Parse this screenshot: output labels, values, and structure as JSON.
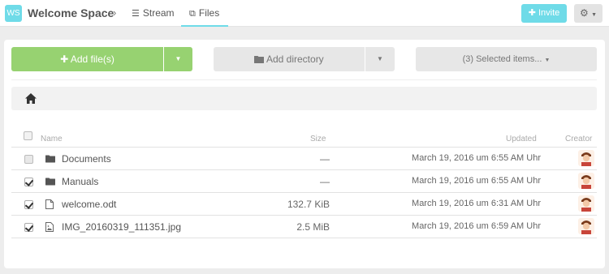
{
  "header": {
    "space_initials": "WS",
    "space_name": "Welcome Space",
    "separator": "›",
    "nav_stream": "Stream",
    "nav_files": "Files",
    "invite_label": "Invite",
    "accent_color": "#6fdbe8"
  },
  "toolbar": {
    "add_files_label": "Add file(s)",
    "add_directory_label": "Add directory",
    "selected_items_label": "(3) Selected items...",
    "add_files_color": "#97d271"
  },
  "table": {
    "columns": {
      "name": "Name",
      "size": "Size",
      "updated": "Updated",
      "creator": "Creator"
    },
    "rows": [
      {
        "type": "folder",
        "name": "Documents",
        "size": "—",
        "updated": "March 19, 2016 um 6:55 AM Uhr",
        "checked": false,
        "icon": "folder-icon"
      },
      {
        "type": "folder",
        "name": "Manuals",
        "size": "—",
        "updated": "March 19, 2016 um 6:55 AM Uhr",
        "checked": true,
        "icon": "folder-icon"
      },
      {
        "type": "file",
        "name": "welcome.odt",
        "size": "132.7 KiB",
        "updated": "March 19, 2016 um 6:31 AM Uhr",
        "checked": true,
        "icon": "file-icon"
      },
      {
        "type": "image",
        "name": "IMG_20160319_111351.jpg",
        "size": "2.5 MiB",
        "updated": "March 19, 2016 um 6:59 AM Uhr",
        "checked": true,
        "icon": "image-file-icon"
      }
    ]
  }
}
